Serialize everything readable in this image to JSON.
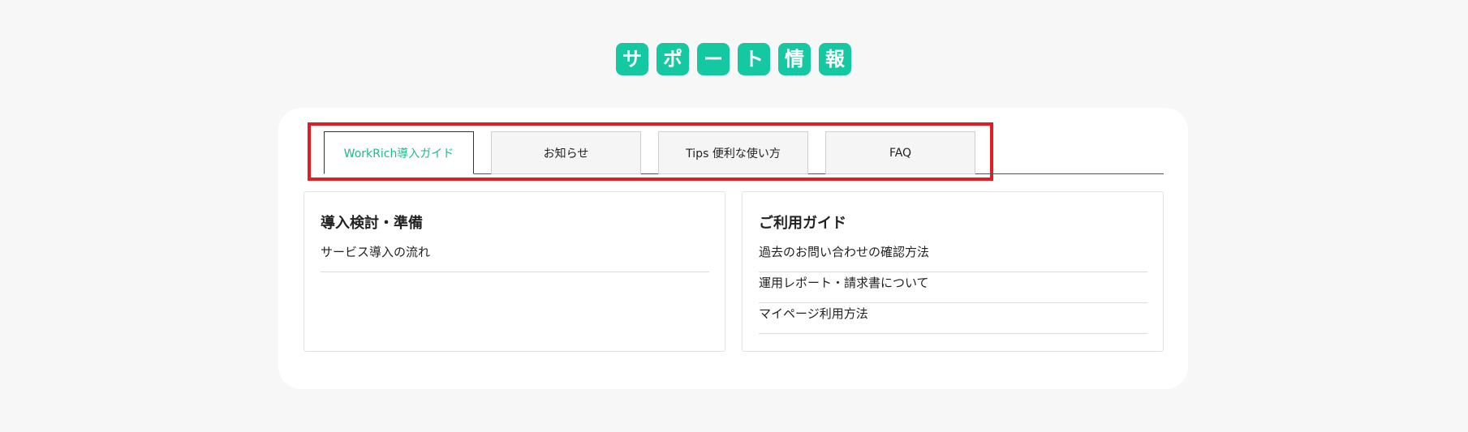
{
  "heading": {
    "chars": [
      "サ",
      "ポ",
      "ー",
      "ト",
      "情",
      "報"
    ]
  },
  "tabs": [
    {
      "label": "WorkRich導入ガイド",
      "active": true
    },
    {
      "label": "お知らせ",
      "active": false
    },
    {
      "label": "Tips 便利な使い方",
      "active": false
    },
    {
      "label": "FAQ",
      "active": false
    }
  ],
  "cards": [
    {
      "title": "導入検討・準備",
      "items": [
        "サービス導入の流れ"
      ]
    },
    {
      "title": "ご利用ガイド",
      "items": [
        "過去のお問い合わせの確認方法",
        "運用レポート・請求書について",
        "マイページ利用方法"
      ]
    }
  ],
  "colors": {
    "accent": "#14c8a2",
    "active_tab_text": "#1fb892",
    "highlight_border": "#e31b23",
    "page_background": "#f7f7f7"
  }
}
